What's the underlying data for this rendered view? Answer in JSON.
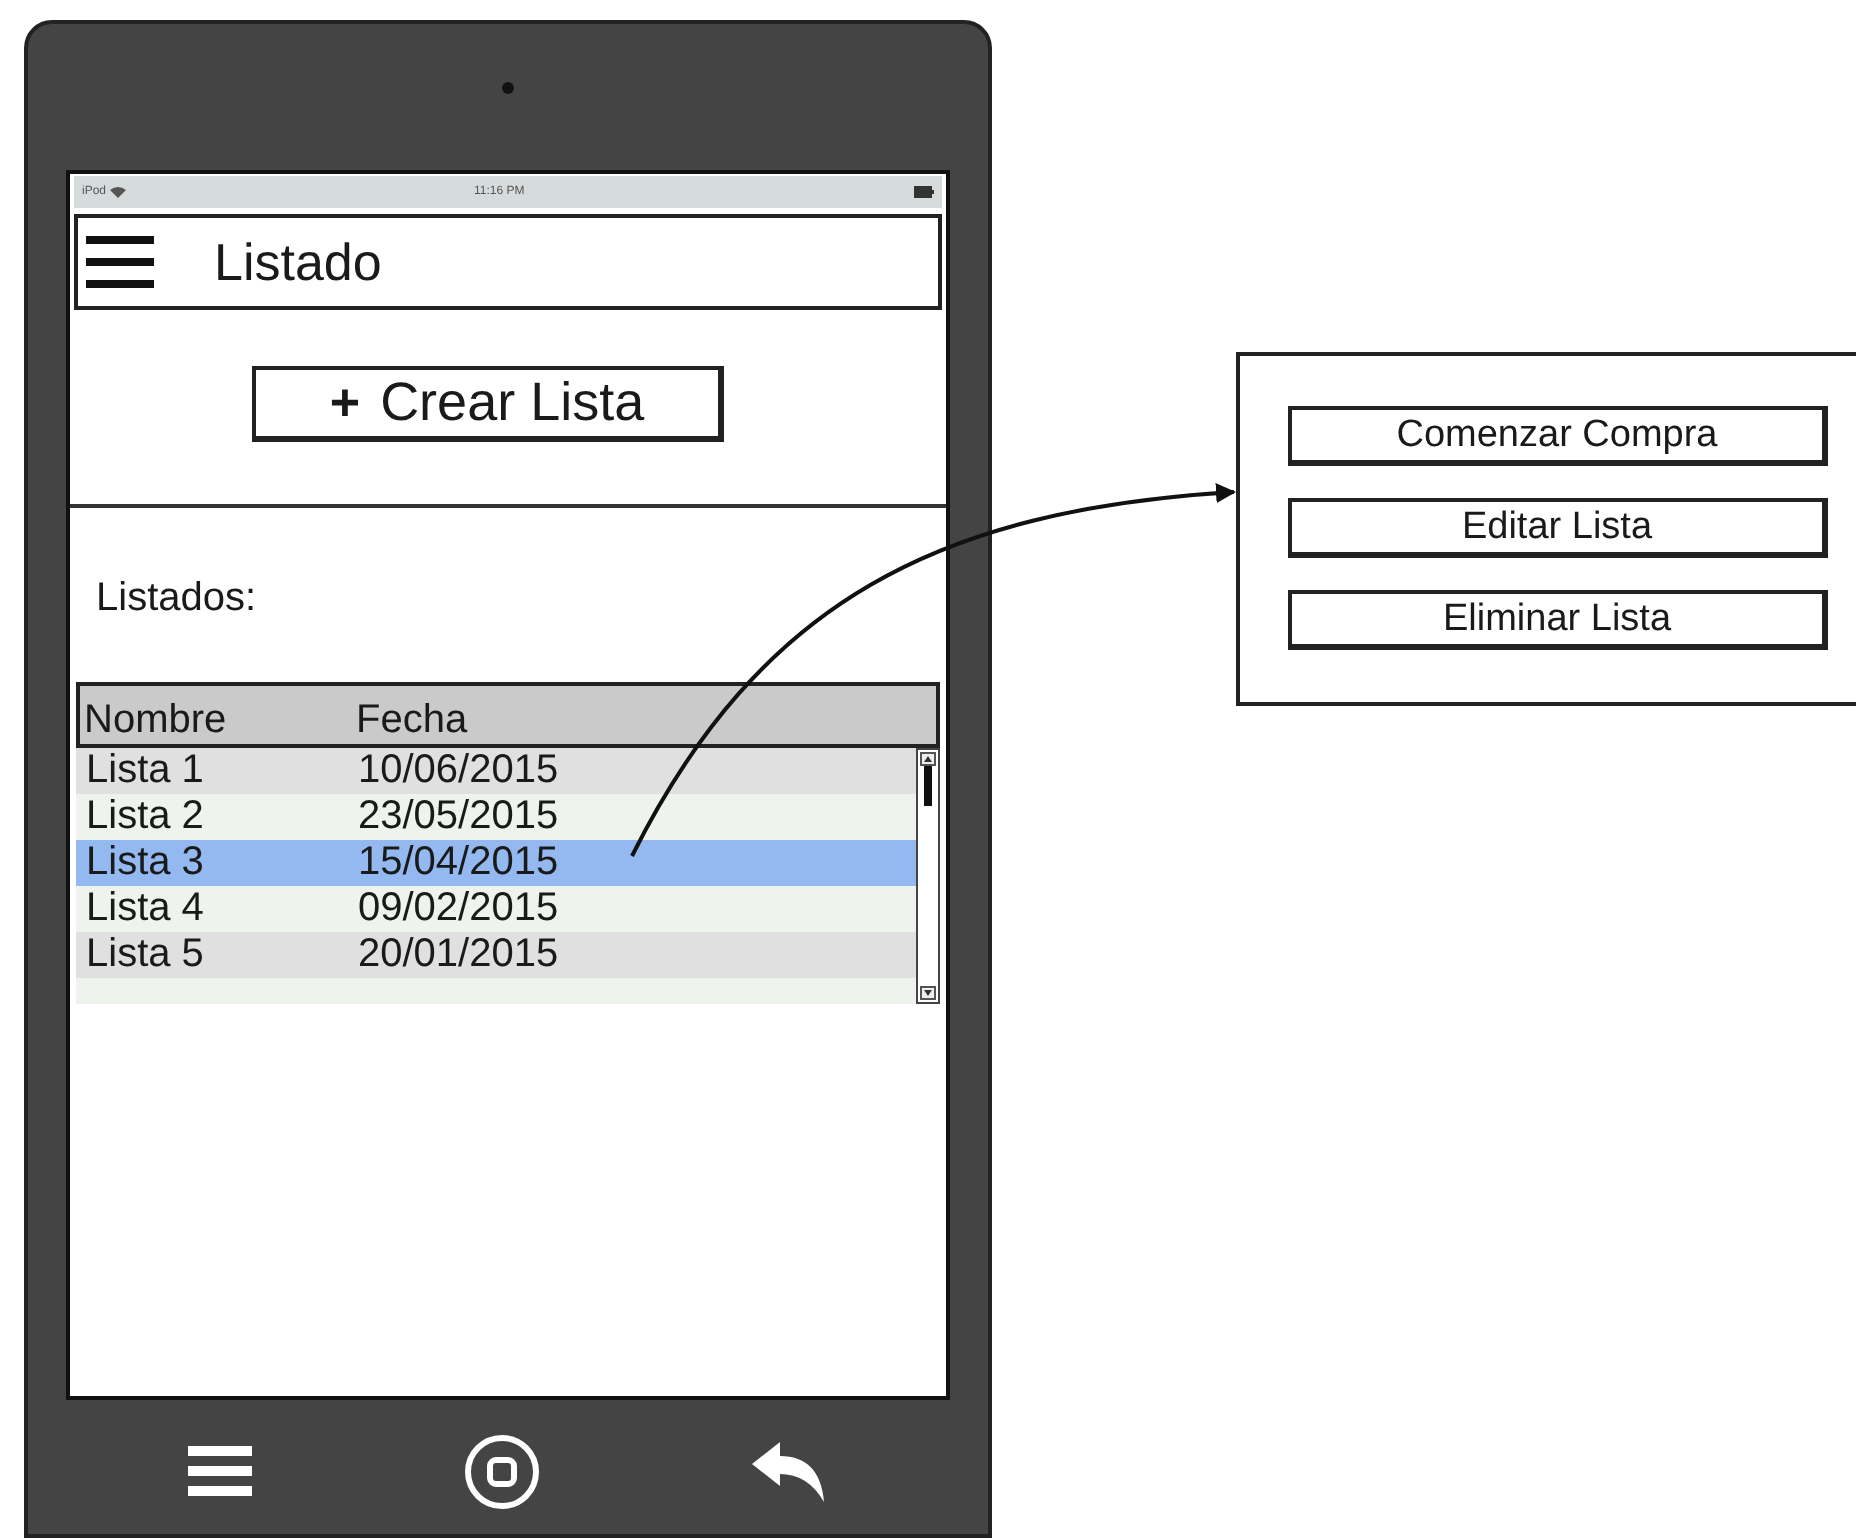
{
  "status_bar": {
    "carrier": "iPod",
    "time": "11:16 PM"
  },
  "header": {
    "title": "Listado"
  },
  "create_button": {
    "icon": "+",
    "label": "Crear Lista"
  },
  "section_label": "Listados:",
  "table": {
    "columns": [
      "Nombre",
      "Fecha"
    ],
    "rows": [
      {
        "cells": [
          "Lista 1",
          "10/06/2015"
        ],
        "selected": false
      },
      {
        "cells": [
          "Lista 2",
          "23/05/2015"
        ],
        "selected": false
      },
      {
        "cells": [
          "Lista 3",
          "15/04/2015"
        ],
        "selected": true
      },
      {
        "cells": [
          "Lista 4",
          "09/02/2015"
        ],
        "selected": false
      },
      {
        "cells": [
          "Lista 5",
          "20/01/2015"
        ],
        "selected": false
      }
    ]
  },
  "context_menu": {
    "buttons": [
      "Comenzar Compra",
      "Editar Lista",
      "Eliminar Lista"
    ]
  }
}
